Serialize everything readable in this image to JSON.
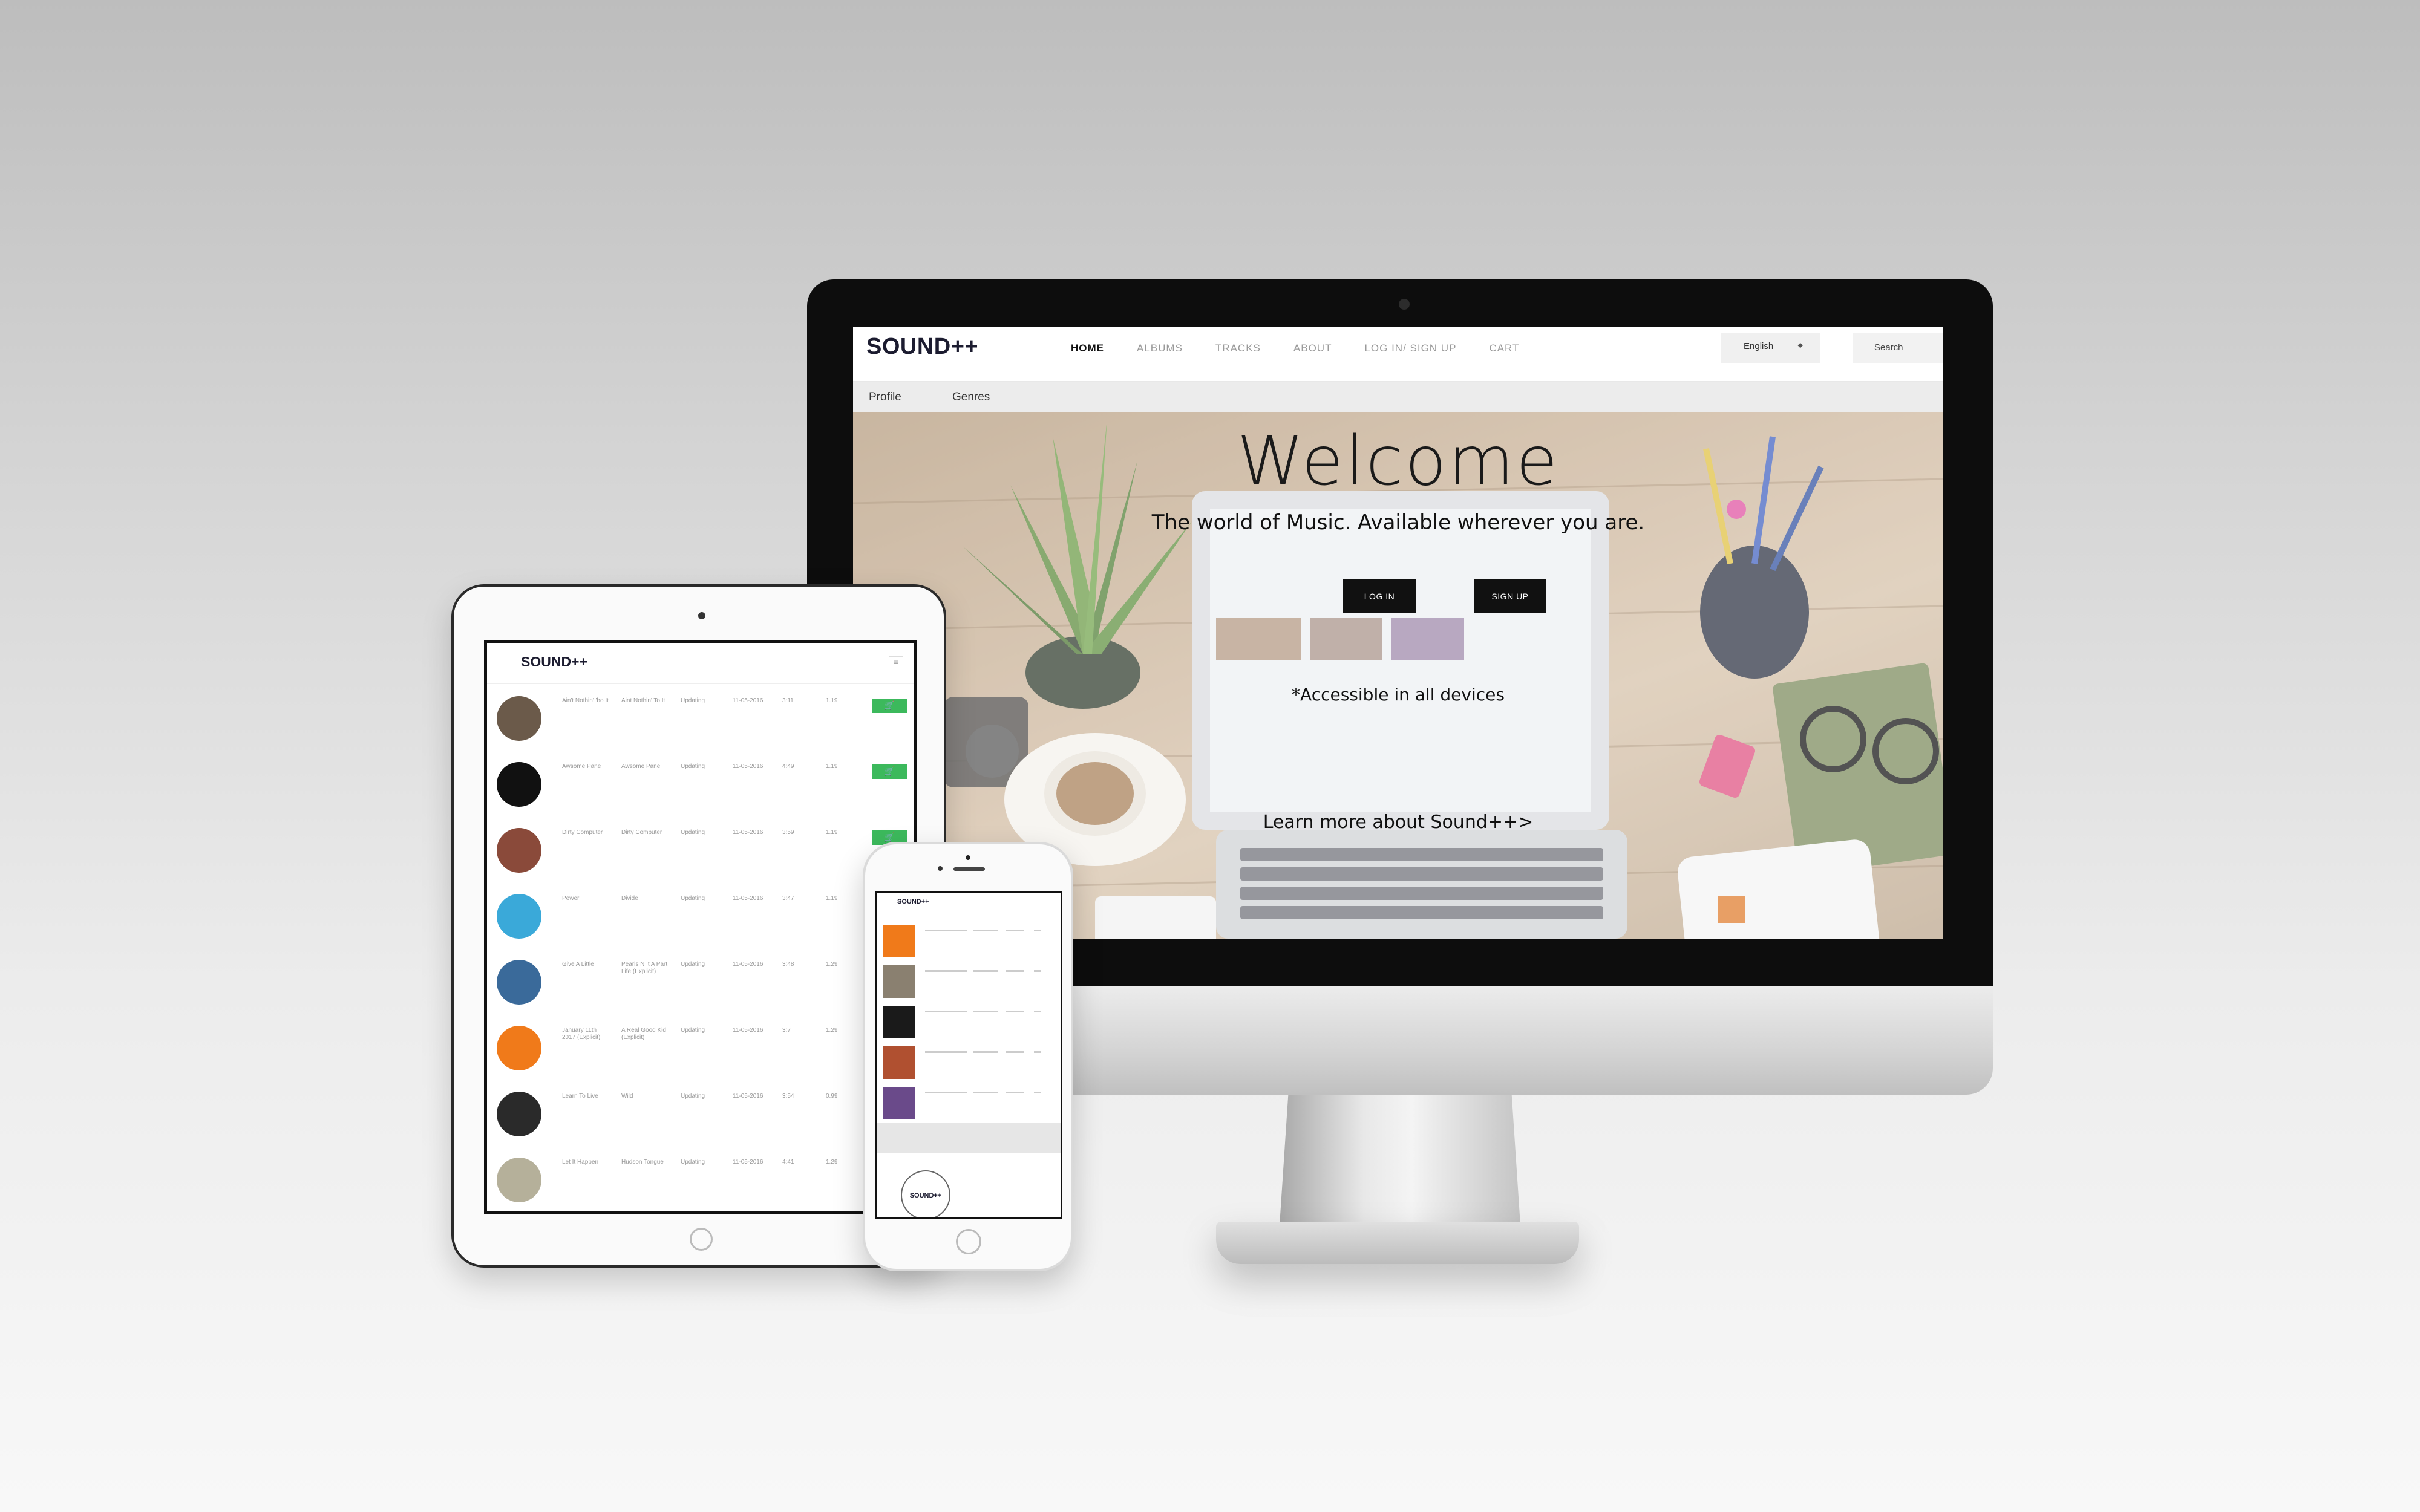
{
  "imac": {
    "nav": {
      "logo": "SOUND++",
      "items": [
        "HOME",
        "ALBUMS",
        "TRACKS",
        "ABOUT",
        "LOG IN/ SIGN UP",
        "CART"
      ],
      "language": "English",
      "search": "Search"
    },
    "subnav": [
      "Profile",
      "Genres"
    ],
    "hero": {
      "title": "Welcome",
      "subtitle": "The world of Music. Available wherever you are.",
      "login_label": "LOG IN",
      "signup_label": "SIGN UP",
      "accessible": "*Accessible in all devices",
      "learn_more": "Learn more about Sound++>"
    }
  },
  "ipad": {
    "logo": "SOUND++",
    "rows": [
      {
        "title": "Ain't Nothin' 'bo It",
        "album": "Aint Nothin' To It",
        "status": "Updating",
        "date": "11-05-2016",
        "duration": "3:11",
        "price": "1.19",
        "cart": true,
        "color": "#6b5a4a"
      },
      {
        "title": "Awsome Pane",
        "album": "Awsome Pane",
        "status": "Updating",
        "date": "11-05-2016",
        "duration": "4:49",
        "price": "1.19",
        "cart": true,
        "color": "#111111"
      },
      {
        "title": "Dirty Computer",
        "album": "Dirty Computer",
        "status": "Updating",
        "date": "11-05-2016",
        "duration": "3:59",
        "price": "1.19",
        "cart": true,
        "color": "#8a4a3a"
      },
      {
        "title": "Pewer",
        "album": "Divide",
        "status": "Updating",
        "date": "11-05-2016",
        "duration": "3:47",
        "price": "1.19",
        "cart": false,
        "color": "#3aa9d9"
      },
      {
        "title": "Give A Little",
        "album": "Pearls N It A Part Life (Explicit)",
        "status": "Updating",
        "date": "11-05-2016",
        "duration": "3:48",
        "price": "1.29",
        "cart": false,
        "color": "#3a6a9a"
      },
      {
        "title": "January 11th 2017 (Explicit)",
        "album": "A Real Good Kid (Explicit)",
        "status": "Updating",
        "date": "11-05-2016",
        "duration": "3:7",
        "price": "1.29",
        "cart": false,
        "color": "#f07a1a"
      },
      {
        "title": "Learn To Live",
        "album": "Wild",
        "status": "Updating",
        "date": "11-05-2016",
        "duration": "3:54",
        "price": "0.99",
        "cart": false,
        "color": "#2a2a2a"
      },
      {
        "title": "Let It Happen",
        "album": "Hudson Tongue",
        "status": "Updating",
        "date": "11-05-2016",
        "duration": "4:41",
        "price": "1.29",
        "cart": false,
        "color": "#b5b09a"
      }
    ]
  },
  "iphone": {
    "logo": "SOUND++",
    "footer_logo": "SOUND++",
    "thumbs": [
      "#f07a1a",
      "#8a8070",
      "#1a1a1a",
      "#b05030",
      "#6a4a8a"
    ]
  },
  "colors": {
    "brand_dark": "#1c1c30",
    "cart_green": "#3cb95c",
    "button_black": "#111111"
  }
}
